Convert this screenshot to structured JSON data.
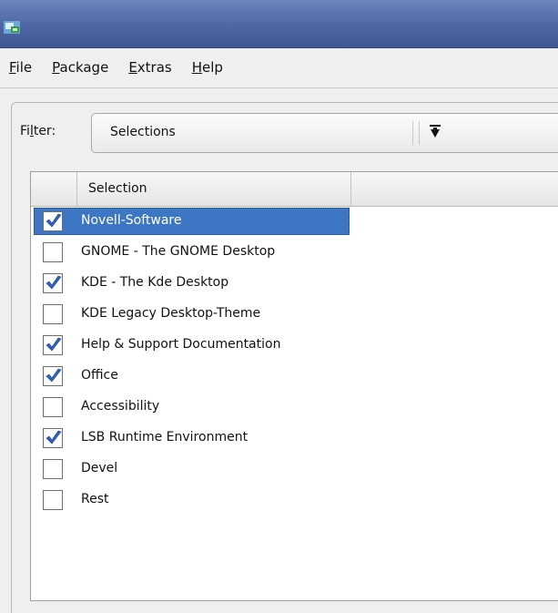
{
  "icons": {
    "app": "yast-software-icon",
    "combo_arrow": "combo-dropdown-arrow-icon",
    "checkbox_mark": "check-icon"
  },
  "colors": {
    "titlebar": "#4e66a2",
    "selection": "#3d77c4",
    "check": "#2f63b7"
  },
  "menubar": {
    "items": [
      {
        "id": "file",
        "prefix": "",
        "mnemonic": "F",
        "rest": "ile"
      },
      {
        "id": "package",
        "prefix": "",
        "mnemonic": "P",
        "rest": "ackage"
      },
      {
        "id": "extras",
        "prefix": "",
        "mnemonic": "E",
        "rest": "xtras"
      },
      {
        "id": "help",
        "prefix": "",
        "mnemonic": "H",
        "rest": "elp"
      }
    ]
  },
  "filter": {
    "label_prefix": "Fi",
    "label_mnemonic": "l",
    "label_rest": "ter:",
    "value": "Selections"
  },
  "list": {
    "column_header": "Selection",
    "rows": [
      {
        "label": "Novell-Software",
        "checked": true,
        "selected": true
      },
      {
        "label": "GNOME - The GNOME Desktop",
        "checked": false,
        "selected": false
      },
      {
        "label": "KDE - The Kde Desktop",
        "checked": true,
        "selected": false
      },
      {
        "label": "KDE Legacy Desktop-Theme",
        "checked": false,
        "selected": false
      },
      {
        "label": "Help & Support Documentation",
        "checked": true,
        "selected": false
      },
      {
        "label": "Office",
        "checked": true,
        "selected": false
      },
      {
        "label": "Accessibility",
        "checked": false,
        "selected": false
      },
      {
        "label": "LSB Runtime Environment",
        "checked": true,
        "selected": false
      },
      {
        "label": "Devel",
        "checked": false,
        "selected": false
      },
      {
        "label": "Rest",
        "checked": false,
        "selected": false
      }
    ]
  }
}
